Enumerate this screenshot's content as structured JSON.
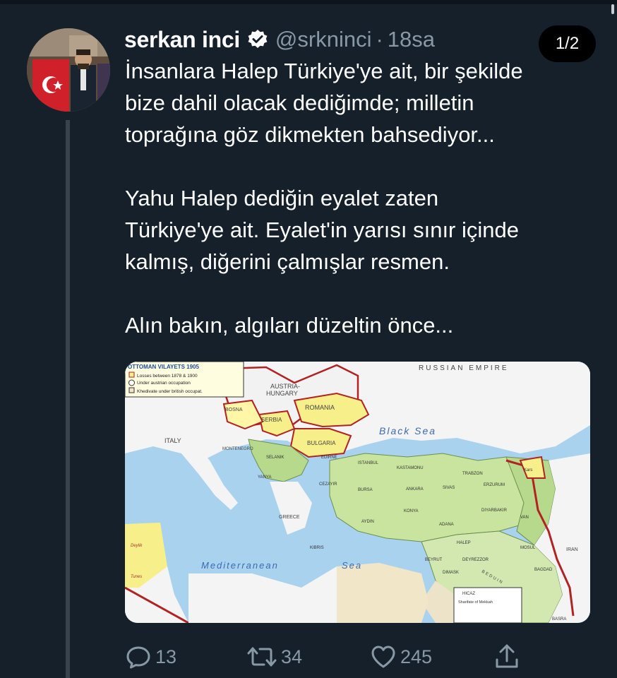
{
  "tweet": {
    "author_name": "serkan inci",
    "handle": "@srkninci",
    "separator": "·",
    "time": "18sa",
    "page_indicator": "1/2",
    "paragraphs": [
      [
        "İnsanlara Halep Türkiye'ye ait, bir şekilde",
        "bize dahil olacak dediğimde; milletin",
        "toprağına göz dikmekten bahsediyor..."
      ],
      [
        "Yahu Halep dediğin eyalet zaten",
        "Türkiye'ye ait. Eyalet'in yarısı sınır içinde",
        "kalmış, diğerini çalmışlar resmen."
      ],
      [
        "Alın bakın, algıları düzeltin önce..."
      ]
    ]
  },
  "map": {
    "legend_title": "OTTOMAN VILAYETS 1905",
    "legend_items": [
      "Losses between 1878 & 1900",
      "Under austrian occupation",
      "Khedivate under british occupat."
    ],
    "labels": {
      "russian_empire": "RUSSIAN EMPIRE",
      "austria": "AUSTRIA-",
      "hungary": "HUNGARY",
      "romania": "ROMANIA",
      "serbia": "SERBIA",
      "bulgaria": "BULGARIA",
      "bosna": "BOSNA",
      "italy": "ITALY",
      "montenegro": "MONTENEGRO",
      "selanik": "SELANIK",
      "edirne": "EDIRNE",
      "istanbul": "ISTANBUL",
      "kastamonu": "KASTAMONU",
      "trabzon": "TRABZON",
      "black_sea": "Black Sea",
      "yanya": "YANYA",
      "cezayir": "CEZAYIR",
      "bursa": "BURSA",
      "ankara": "ANKARA",
      "sivas": "SIVAS",
      "erzurum": "ERZURUM",
      "kars": "Kars",
      "greece": "GREECE",
      "aydin": "AYDIN",
      "konya": "KONYA",
      "diyarbakir": "DIYARBAKIR",
      "van": "VAN",
      "adana": "ADANA",
      "halep": "HALEP",
      "mosul": "MOSUL",
      "iran": "IRAN",
      "mediterranean": "Mediterranean",
      "sea": "Sea",
      "kibris": "KIBRIS",
      "beyrut": "BEYRUT",
      "deyrezzor": "DEYREZZOR",
      "dimask": "DIMASK",
      "bagdad": "BAGDAD",
      "basra": "BASRA",
      "hicaz": "HICAZ",
      "sharifate": "Sharifate of Mekkah",
      "beduin": "BEDUIN",
      "tunes": "Tunes",
      "deylik": "Deylik"
    }
  },
  "actions": {
    "replies": "13",
    "retweets": "34",
    "likes": "245"
  },
  "icons": {
    "verified": "verified-badge-icon",
    "reply": "reply-icon",
    "retweet": "retweet-icon",
    "like": "heart-icon",
    "share": "share-icon"
  },
  "colors": {
    "background": "#15202b",
    "secondary_text": "#8899a6",
    "thread_line": "#38444d"
  }
}
